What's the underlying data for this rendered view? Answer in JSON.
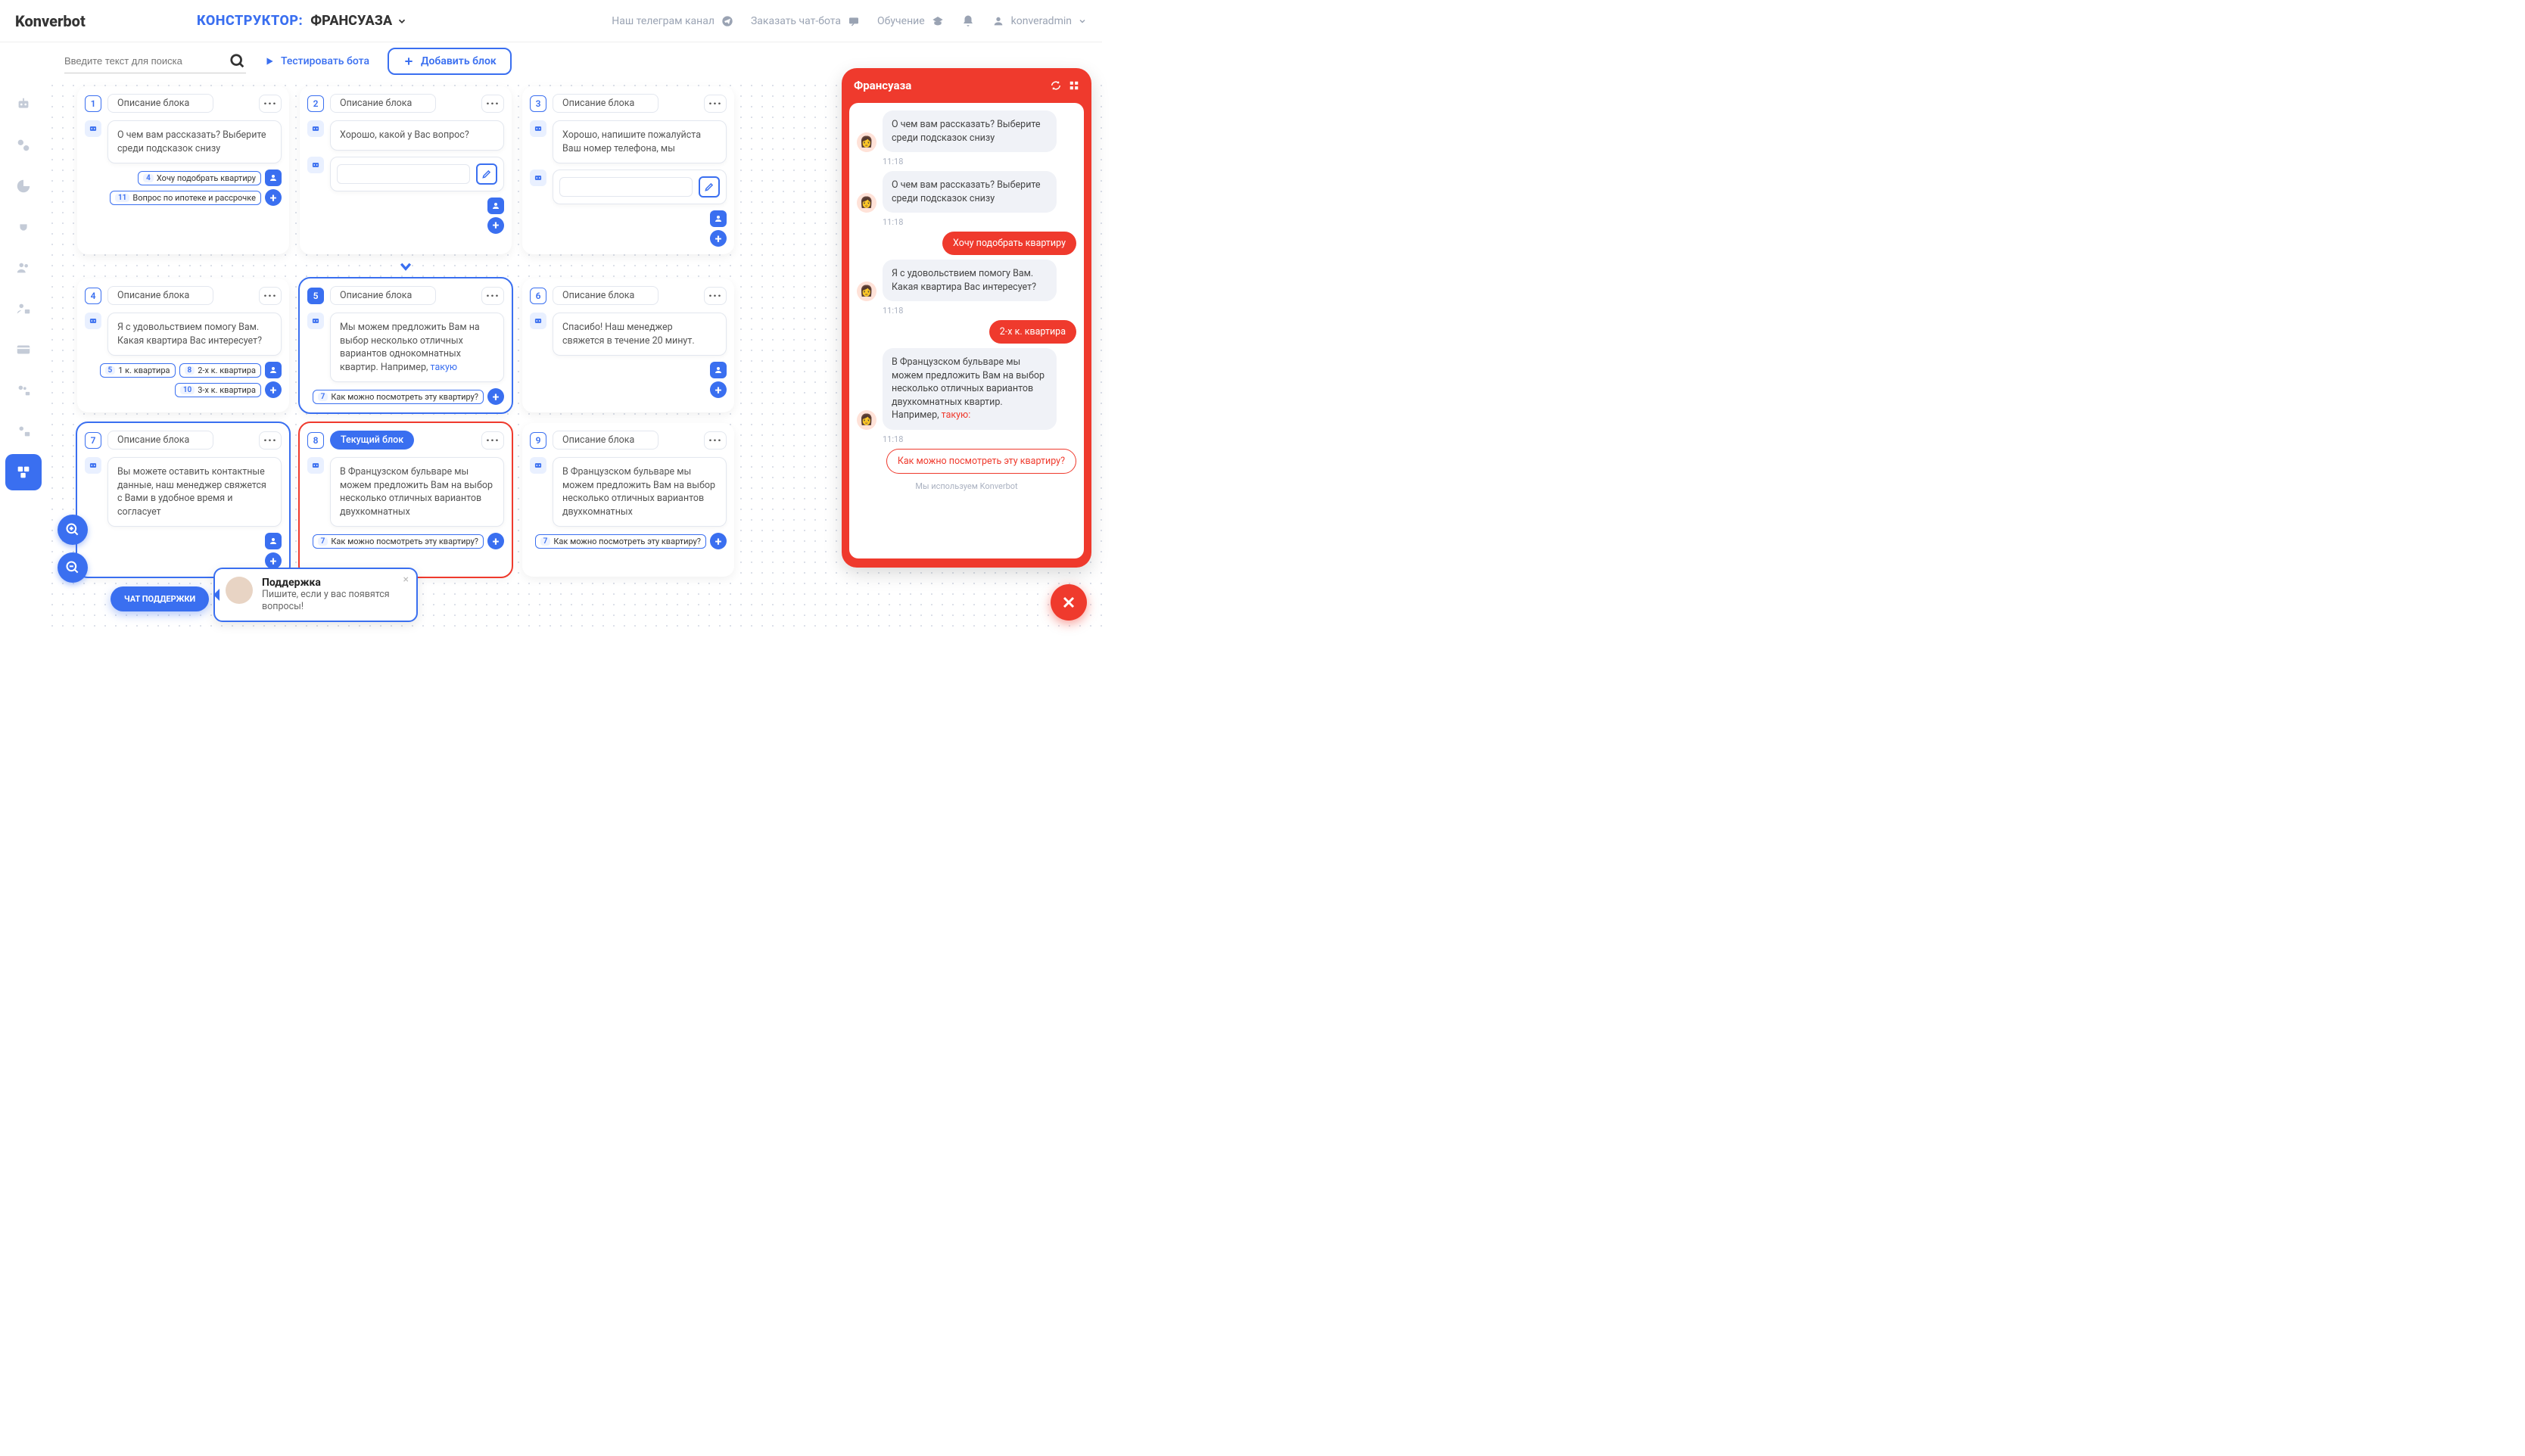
{
  "logo": "Konverbot",
  "constructor_label": "КОНСТРУКТОР:",
  "bot_name": "ФРАНСУАЗА",
  "top_links": {
    "telegram": "Наш телеграм канал",
    "order": "Заказать чат-бота",
    "learn": "Обучение"
  },
  "user_name": "konveradmin",
  "search_placeholder": "Введите текст для поиска",
  "test_bot_label": "Тестировать бота",
  "add_block_label": "Добавить блок",
  "blocks": [
    {
      "n": "1",
      "desc": "Описание блока",
      "msg": "О чем вам рассказать? Выберите среди подсказок снизу",
      "tags": [
        {
          "n": "4",
          "t": "Хочу подобрать квартиру"
        },
        {
          "n": "11",
          "t": "Вопрос по ипотеке и рассрочке"
        }
      ]
    },
    {
      "n": "2",
      "desc": "Описание блока",
      "msg": "Хорошо, какой у Вас вопрос?",
      "input": true
    },
    {
      "n": "3",
      "desc": "Описание блока",
      "msg": "Хорошо, напишите пожалуйста Ваш номер телефона, мы",
      "input": true
    },
    {
      "n": "4",
      "desc": "Описание блока",
      "msg": "Я с удовольствием помогу Вам. Какая квартира Вас интересует?",
      "tags": [
        {
          "n": "5",
          "t": "1 к. квартира"
        },
        {
          "n": "8",
          "t": "2-х к. квартира"
        },
        {
          "n": "10",
          "t": "3-х к. квартира"
        }
      ]
    },
    {
      "n": "5",
      "desc": "Описание блока",
      "msg": "Мы можем предложить Вам на выбор несколько отличных вариантов однокомнатных квартир. Например, ",
      "msg_link": "такую",
      "tags": [
        {
          "n": "7",
          "t": "Как можно посмотреть эту квартиру?"
        }
      ],
      "solid": true,
      "sel": "blue"
    },
    {
      "n": "6",
      "desc": "Описание блока",
      "msg": "Спасибо! Наш менеджер свяжется в течение 20 минут."
    },
    {
      "n": "7",
      "desc": "Описание блока",
      "msg": "Вы можете оставить контактные данные, наш менеджер свяжется с Вами в удобное время и согласует",
      "sel": "blue"
    },
    {
      "n": "8",
      "desc": "Текущий блок",
      "msg": "В Французском бульваре мы можем предложить Вам на выбор несколько отличных вариантов двухкомнатных",
      "tags": [
        {
          "n": "7",
          "t": "Как можно посмотреть эту квартиру?"
        }
      ],
      "chip": true,
      "sel": "red"
    },
    {
      "n": "9",
      "desc": "Описание блока",
      "msg": "В Французском бульваре мы можем предложить Вам на выбор несколько отличных вариантов двухкомнатных",
      "tags": [
        {
          "n": "7",
          "t": "Как можно посмотреть эту квартиру?"
        }
      ]
    }
  ],
  "support": {
    "pill": "ЧАТ ПОДДЕРЖКИ",
    "title": "Поддержка",
    "text": "Пишите, если у вас появятся вопросы!"
  },
  "preview": {
    "title": "Франсуаза",
    "messages": [
      {
        "type": "bot",
        "text": "О чем вам рассказать? Выберите среди подсказок снизу",
        "time": "11:18"
      },
      {
        "type": "bot",
        "text": "О чем вам рассказать? Выберите среди подсказок снизу",
        "time": "11:18"
      },
      {
        "type": "user",
        "text": "Хочу подобрать квартиру"
      },
      {
        "type": "bot",
        "text": "Я с удовольствием помогу Вам. Какая квартира Вас интересует?",
        "time": "11:18"
      },
      {
        "type": "user",
        "text": "2-х к. квартира"
      },
      {
        "type": "bot",
        "text": "В Французском бульваре мы можем предложить Вам на выбор несколько отличных вариантов двухкомнатных квартир. Например, ",
        "text_link": "такую:",
        "time": "11:18"
      },
      {
        "type": "button",
        "text": "Как можно посмотреть эту квартиру?"
      }
    ],
    "footer": "Мы используем Konverbot"
  }
}
